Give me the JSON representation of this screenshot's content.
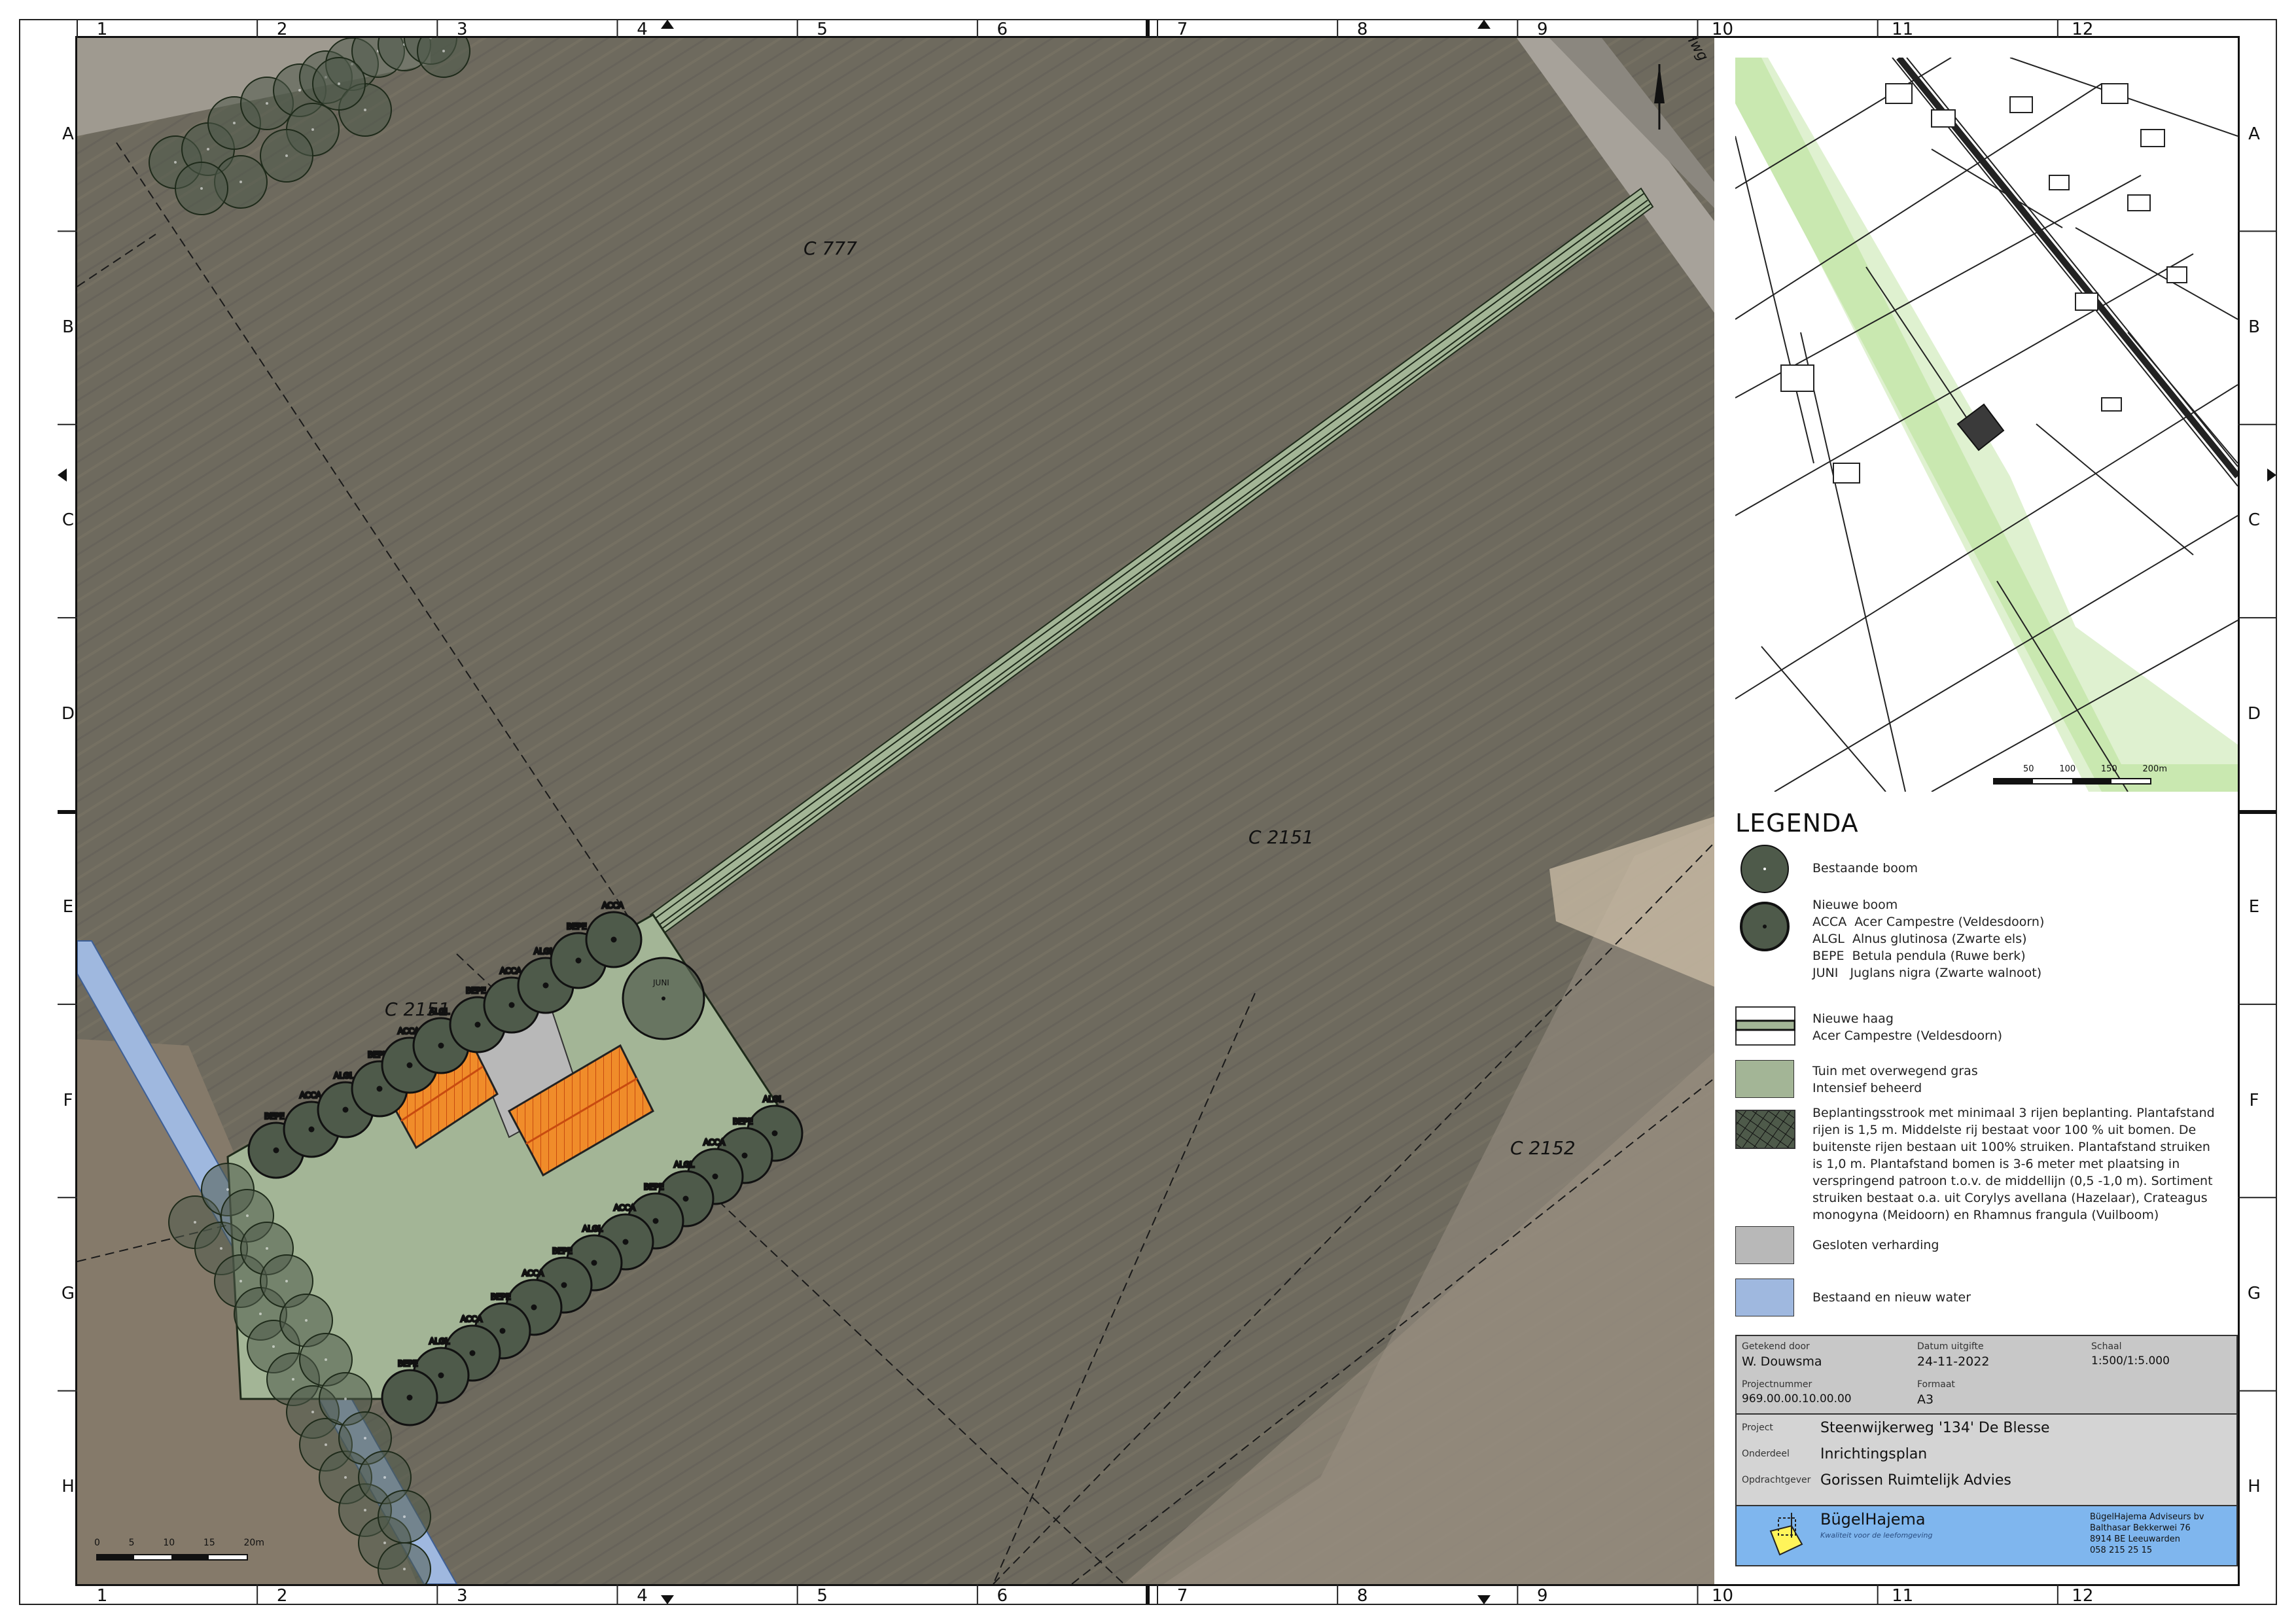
{
  "grid": {
    "columns": [
      "1",
      "2",
      "3",
      "4",
      "5",
      "6",
      "7",
      "8",
      "9",
      "10",
      "11",
      "12"
    ],
    "rows": [
      "A",
      "B",
      "C",
      "D",
      "E",
      "F",
      "G",
      "H"
    ]
  },
  "map": {
    "parcels": [
      "C 777",
      "C 2151",
      "C 2152",
      "C 2151"
    ],
    "road_label": "Hwg",
    "scalebar": [
      "0",
      "5",
      "10",
      "15",
      "20m"
    ],
    "tree_codes": [
      "BEPE",
      "ACCA",
      "ALGL",
      "BEPE",
      "ACCA",
      "ALGL",
      "BEPE",
      "ACCA",
      "ALGL",
      "BEPE",
      "ACCA",
      "ALGL",
      "BEPE",
      "ACCA",
      "ALGL",
      "BEPE",
      "ACCA",
      "ALGL",
      "BEPE",
      "ACCA",
      "JUNI"
    ]
  },
  "overview": {
    "scalebar": [
      "50",
      "100",
      "150",
      "200m"
    ]
  },
  "legend": {
    "title": "LEGENDA",
    "items": [
      {
        "text": "Bestaande boom"
      },
      {
        "text": "Nieuwe boom\nACCA  Acer Campestre (Veldesdoorn)\nALGL  Alnus glutinosa (Zwarte els)\nBEPE  Betula pendula (Ruwe berk)\nJUNI   Juglans nigra (Zwarte walnoot)"
      },
      {
        "text": "Nieuwe haag\nAcer Campestre (Veldesdoorn)"
      },
      {
        "text": "Tuin met overwegend gras\nIntensief beheerd"
      },
      {
        "text": "Beplantingsstrook met minimaal 3 rijen beplanting. Plantafstand\nrijen is 1,5 m. Middelste rij bestaat voor 100 % uit bomen. De\nbuitenste rijen bestaan uit 100% struiken. Plantafstand struiken\nis 1,0 m. Plantafstand bomen is 3-6 meter met plaatsing in\nverspringend patroon t.o.v. de middellijn (0,5 -1,0 m). Sortiment\nstruiken bestaat o.a. uit Corylys avellana (Hazelaar), Crateagus\nmonogyna (Meidoorn) en Rhamnus frangula (Vuilboom)"
      },
      {
        "text": "Gesloten verharding"
      },
      {
        "text": "Bestaand en nieuw water"
      }
    ]
  },
  "titleblock": {
    "drawn_by_label": "Getekend door",
    "drawn_by": "W. Douwsma",
    "date_label": "Datum uitgifte",
    "date": "24-11-2022",
    "scale_label": "Schaal",
    "scale": "1:500/1:5.000",
    "project_no_label": "Projectnummer",
    "project_no": "969.00.00.10.00.00",
    "format_label": "Formaat",
    "format": "A3",
    "project_label": "Project",
    "project": "Steenwijkerweg '134' De Blesse",
    "part_label": "Onderdeel",
    "part": "Inrichtingsplan",
    "client_label": "Opdrachtgever",
    "client": "Gorissen Ruimtelijk Advies",
    "company_name": "BügelHajema",
    "company_slogan": "Kwaliteit voor de leefomgeving",
    "address": [
      "BügelHajema Adviseurs bv",
      "Balthasar Bekkerwei 76",
      "8914 BE Leeuwarden",
      "058 215 25 15"
    ]
  },
  "colors": {
    "field": "#6f6a5e",
    "garden": "#a3b596",
    "tree": "#4e5a4a",
    "water": "#9fb8df",
    "paving": "#b8b8b8",
    "roof": "#f08c2a",
    "overview_green": "#c9e8b0",
    "brand_blue": "#7fb6ee",
    "titleblock_grey": "#c8c8c8"
  }
}
